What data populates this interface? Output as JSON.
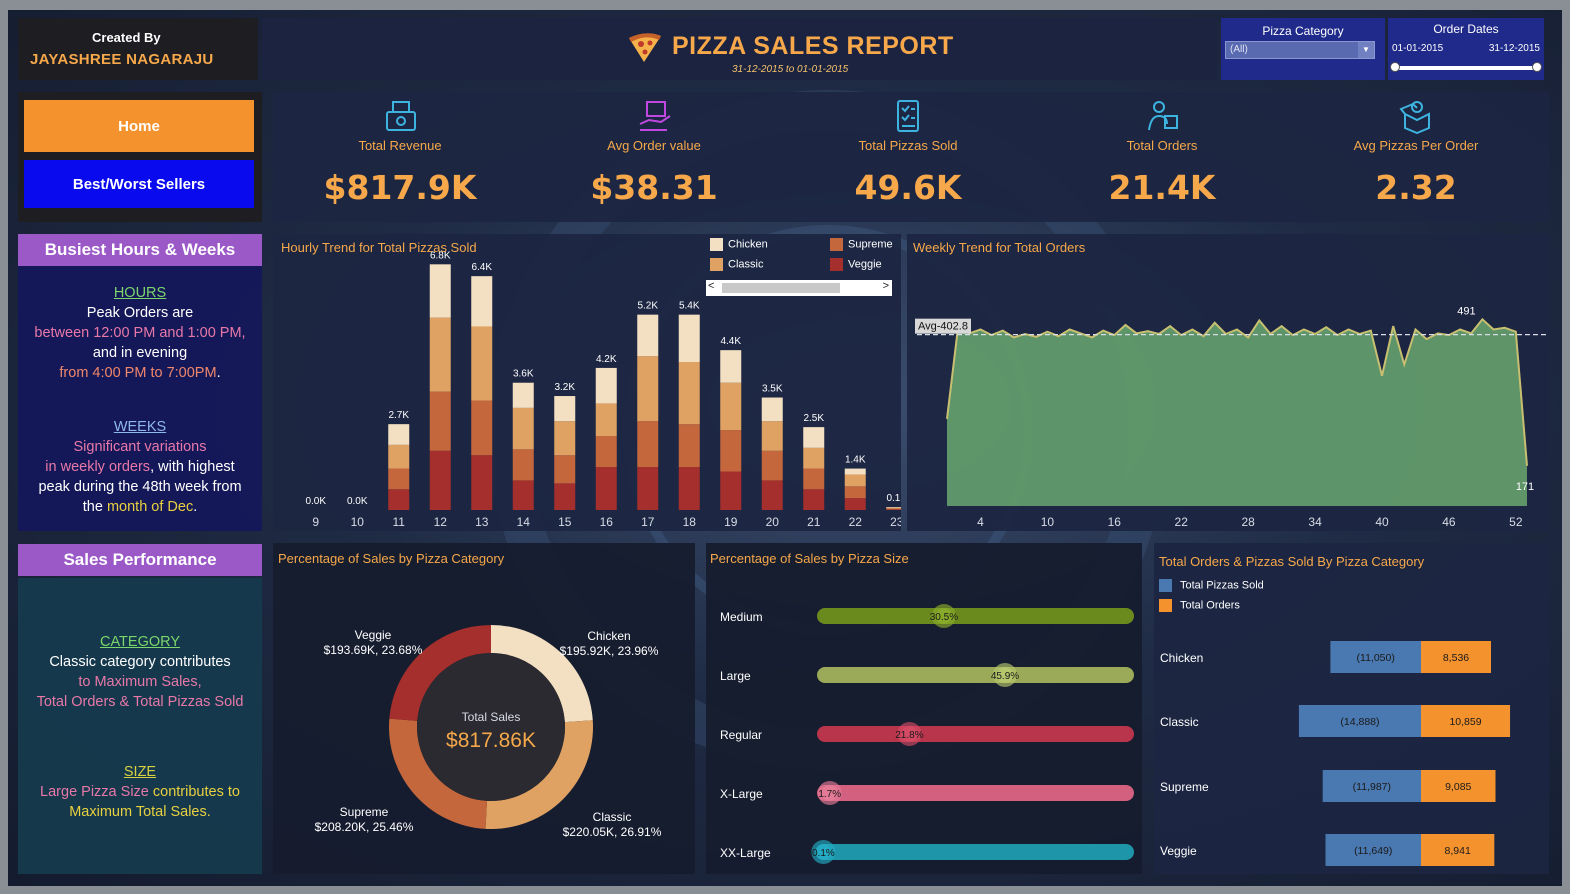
{
  "header": {
    "created_by_label": "Created By",
    "author": "JAYASHREE NAGARAJU",
    "title": "PIZZA SALES REPORT",
    "date_range": "31-12-2015 to 01-01-2015",
    "category_slicer": {
      "label": "Pizza Category",
      "value": "(All)"
    },
    "date_slicer": {
      "label": "Order Dates",
      "start": "01-01-2015",
      "end": "31-12-2015"
    }
  },
  "nav": {
    "home": "Home",
    "best_worst": "Best/Worst Sellers"
  },
  "kpis": [
    {
      "label": "Total Revenue",
      "value": "$817.9K",
      "icon": "money-register-icon"
    },
    {
      "label": "Avg Order value",
      "value": "$38.31",
      "icon": "hand-box-icon"
    },
    {
      "label": "Total Pizzas Sold",
      "value": "49.6K",
      "icon": "checklist-icon"
    },
    {
      "label": "Total Orders",
      "value": "21.4K",
      "icon": "delivery-person-icon"
    },
    {
      "label": "Avg Pizzas Per Order",
      "value": "2.32",
      "icon": "open-box-icon"
    }
  ],
  "busiest": {
    "title": "Busiest Hours & Weeks",
    "hours_head": "HOURS",
    "hours_l1": "Peak Orders are",
    "hours_l2": "between 12:00 PM and 1:00 PM,",
    "hours_l3": "and in evening",
    "hours_l4": "from 4:00 PM to 7:00PM",
    "hours_l4_end": ".",
    "weeks_head": "WEEKS",
    "weeks_l1": "Significant variations",
    "weeks_l2a": "in weekly orders",
    "weeks_l2b": ", with highest",
    "weeks_l3": "peak during the 48th week from",
    "weeks_l4a": "the ",
    "weeks_l4b": "month of Dec",
    "weeks_l4c": "."
  },
  "performance": {
    "title": "Sales Performance",
    "cat_head": "CATEGORY",
    "cat_l1": "Classic category contributes",
    "cat_l2": "to Maximum Sales,",
    "cat_l3": "Total Orders & Total Pizzas Sold",
    "size_head": "SIZE",
    "size_l1a": "Large Pizza Size",
    "size_l1b": " contributes to",
    "size_l2": "Maximum  Total Sales."
  },
  "colors": {
    "chicken": "#f3dfc1",
    "classic": "#e0a263",
    "supreme": "#c4673d",
    "veggie": "#a52f2c",
    "accent": "#f6a84a"
  },
  "hourly_chart": {
    "title": "Hourly Trend for Total Pizzas Sold",
    "legend": [
      "Chicken",
      "Supreme",
      "Classic",
      "Veggie"
    ],
    "chart_data": {
      "type": "bar",
      "stacked": true,
      "categories": [
        "9",
        "10",
        "11",
        "12",
        "13",
        "14",
        "15",
        "16",
        "17",
        "18",
        "19",
        "20",
        "21",
        "22",
        "23"
      ],
      "totals_labels": [
        "0.0K",
        "0.0K",
        "2.7K",
        "6.8K",
        "6.4K",
        "3.6K",
        "3.2K",
        "4.2K",
        "5.2K",
        "5.4K",
        "4.4K",
        "3.5K",
        "2.5K",
        "1.4K",
        "0.1K"
      ],
      "series": [
        {
          "name": "Veggie",
          "values": [
            0.0,
            0.0,
            0.7,
            2.0,
            1.85,
            1.0,
            0.9,
            1.45,
            1.45,
            1.45,
            1.3,
            1.0,
            0.7,
            0.4,
            0.02
          ]
        },
        {
          "name": "Supreme",
          "values": [
            0.0,
            0.0,
            0.7,
            2.0,
            1.85,
            1.05,
            0.95,
            1.05,
            1.55,
            1.45,
            1.4,
            1.0,
            0.7,
            0.4,
            0.03
          ]
        },
        {
          "name": "Classic",
          "values": [
            0.0,
            0.0,
            0.8,
            2.5,
            2.5,
            1.4,
            1.15,
            1.1,
            2.2,
            2.1,
            1.6,
            1.0,
            0.7,
            0.4,
            0.03
          ]
        },
        {
          "name": "Chicken",
          "values": [
            0.0,
            0.0,
            0.7,
            1.8,
            1.7,
            0.85,
            0.85,
            1.2,
            1.4,
            1.6,
            1.1,
            0.8,
            0.7,
            0.2,
            0.02
          ]
        }
      ],
      "ylim": [
        0,
        7.5
      ]
    }
  },
  "weekly_chart": {
    "title": "Weekly Trend for Total Orders",
    "avg_label": "Avg-402.8",
    "peak_label": "491",
    "end_label": "171",
    "chart_data": {
      "type": "area",
      "x_ticks": [
        4,
        10,
        16,
        22,
        28,
        34,
        40,
        46,
        52
      ],
      "x": [
        1,
        2,
        3,
        4,
        5,
        6,
        7,
        8,
        9,
        10,
        11,
        12,
        13,
        14,
        15,
        16,
        17,
        18,
        19,
        20,
        21,
        22,
        23,
        24,
        25,
        26,
        27,
        28,
        29,
        30,
        31,
        32,
        33,
        34,
        35,
        36,
        37,
        38,
        39,
        40,
        41,
        42,
        43,
        44,
        45,
        46,
        47,
        48,
        49,
        50,
        51,
        52,
        53
      ],
      "values": [
        254,
        418,
        405,
        412,
        402,
        410,
        398,
        404,
        399,
        408,
        400,
        412,
        405,
        398,
        410,
        402,
        420,
        405,
        409,
        404,
        418,
        402,
        412,
        400,
        424,
        404,
        412,
        398,
        428,
        404,
        418,
        402,
        412,
        404,
        416,
        402,
        412,
        404,
        410,
        330,
        418,
        350,
        412,
        395,
        405,
        402,
        412,
        405,
        430,
        412,
        415,
        408,
        171
      ],
      "average": 402.8,
      "ylim": [
        100,
        510
      ]
    }
  },
  "category_donut": {
    "title": "Percentage of Sales by Pizza Category",
    "center_label": "Total Sales",
    "center_value": "$817.86K",
    "chart_data": {
      "type": "pie",
      "slices": [
        {
          "name": "Chicken",
          "value": 195.92,
          "l1": "Chicken",
          "l2": "$195.92K, 23.96%"
        },
        {
          "name": "Classic",
          "value": 220.05,
          "l1": "Classic",
          "l2": "$220.05K, 26.91%"
        },
        {
          "name": "Supreme",
          "value": 208.2,
          "l1": "Supreme",
          "l2": "$208.20K, 25.46%"
        },
        {
          "name": "Veggie",
          "value": 193.69,
          "l1": "Veggie",
          "l2": "$193.69K, 23.68%"
        }
      ]
    }
  },
  "size_chart": {
    "title": "Percentage of Sales by Pizza Size",
    "chart_data": {
      "type": "bar",
      "categories": [
        "Medium",
        "Large",
        "Regular",
        "X-Large",
        "XX-Large"
      ],
      "values": [
        30.5,
        45.9,
        21.8,
        1.7,
        0.1
      ],
      "labels": [
        "30.5%",
        "45.9%",
        "21.8%",
        "1.7%",
        "0.1%"
      ],
      "colors": [
        "#6b8a1e",
        "#9aaa58",
        "#b8354c",
        "#d2607e",
        "#1f95aa"
      ],
      "knob_colors": [
        "#88aa2a",
        "#b6c66c",
        "#d44a64",
        "#e47a96",
        "#24aac2"
      ]
    }
  },
  "orders_chart": {
    "title": "Total Orders & Pizzas Sold By Pizza Category",
    "legend": [
      "Total Pizzas Sold",
      "Total Orders"
    ],
    "chart_data": {
      "type": "bar",
      "categories": [
        "Chicken",
        "Classic",
        "Supreme",
        "Veggie"
      ],
      "series": [
        {
          "name": "Total Pizzas Sold",
          "values": [
            11050,
            14888,
            11987,
            11649
          ],
          "labels": [
            "(11,050)",
            "(14,888)",
            "(11,987)",
            "(11,649)"
          ]
        },
        {
          "name": "Total Orders",
          "values": [
            8536,
            10859,
            9085,
            8941
          ],
          "labels": [
            "8,536",
            "10,859",
            "9,085",
            "8,941"
          ]
        }
      ]
    }
  }
}
